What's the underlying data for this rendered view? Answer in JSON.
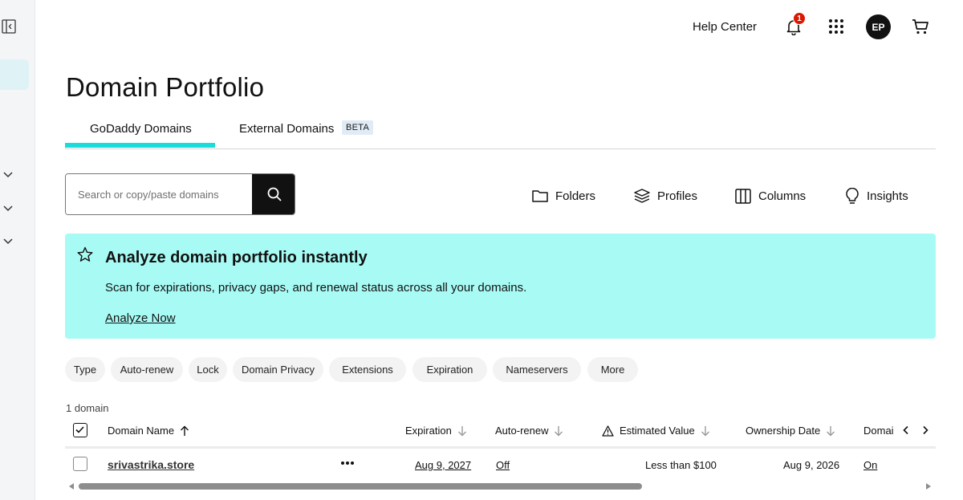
{
  "header": {
    "help_center": "Help Center",
    "notification_count": "1",
    "avatar_initials": "EP"
  },
  "page": {
    "title": "Domain Portfolio"
  },
  "tabs": [
    {
      "label": "GoDaddy Domains",
      "active": true
    },
    {
      "label": "External Domains",
      "badge": "BETA"
    }
  ],
  "search": {
    "placeholder": "Search or copy/paste domains"
  },
  "toolbar": {
    "folders": "Folders",
    "profiles": "Profiles",
    "columns": "Columns",
    "insights": "Insights"
  },
  "banner": {
    "title": "Analyze domain portfolio instantly",
    "text": "Scan for expirations, privacy gaps, and renewal status across all your domains.",
    "link": "Analyze Now"
  },
  "filters": [
    "Type",
    "Auto-renew",
    "Lock",
    "Domain Privacy",
    "Extensions",
    "Expiration",
    "Nameservers",
    "More"
  ],
  "table": {
    "count": "1 domain",
    "columns": {
      "domain_name": "Domain Name",
      "expiration": "Expiration",
      "auto_renew": "Auto-renew",
      "estimated_value": "Estimated Value",
      "ownership_date": "Ownership Date",
      "domain_privacy": "Domai"
    },
    "rows": [
      {
        "domain": "srivastrika.store",
        "expiration": "Aug 9, 2027",
        "auto_renew": "Off",
        "estimated_value": "Less than $100",
        "ownership_date": "Aug 9, 2026",
        "domain_privacy": "On"
      }
    ]
  },
  "colors": {
    "accent_teal": "#1bdbdb",
    "banner_bg": "#a8fbf5",
    "badge_red": "#db1802"
  }
}
